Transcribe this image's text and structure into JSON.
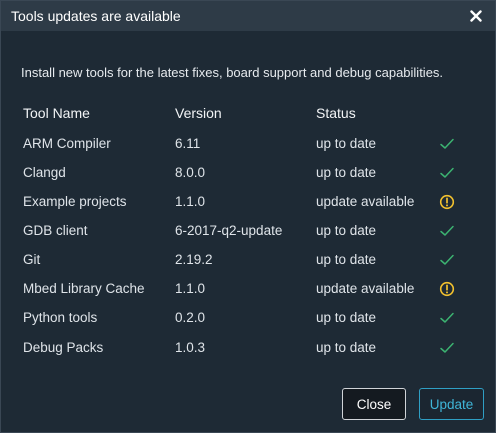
{
  "dialog": {
    "title": "Tools updates are available",
    "intro": "Install new tools for the latest fixes, board support and debug capabilities."
  },
  "table": {
    "headers": {
      "name": "Tool Name",
      "version": "Version",
      "status": "Status"
    },
    "rows": [
      {
        "name": "ARM Compiler",
        "version": "6.11",
        "status": "up to date",
        "icon": "check-icon"
      },
      {
        "name": "Clangd",
        "version": "8.0.0",
        "status": "up to date",
        "icon": "check-icon"
      },
      {
        "name": "Example projects",
        "version": "1.1.0",
        "status": "update available",
        "icon": "warning-icon"
      },
      {
        "name": "GDB client",
        "version": "6-2017-q2-update",
        "status": "up to date",
        "icon": "check-icon"
      },
      {
        "name": "Git",
        "version": "2.19.2",
        "status": "up to date",
        "icon": "check-icon"
      },
      {
        "name": "Mbed Library Cache",
        "version": "1.1.0",
        "status": "update available",
        "icon": "warning-icon"
      },
      {
        "name": "Python tools",
        "version": "0.2.0",
        "status": "up to date",
        "icon": "check-icon"
      },
      {
        "name": "Debug Packs",
        "version": "1.0.3",
        "status": "up to date",
        "icon": "check-icon"
      }
    ]
  },
  "buttons": {
    "close": "Close",
    "update": "Update"
  },
  "colors": {
    "check": "#3cb371",
    "warning": "#f2c12e",
    "accent": "#2f9fc4"
  }
}
